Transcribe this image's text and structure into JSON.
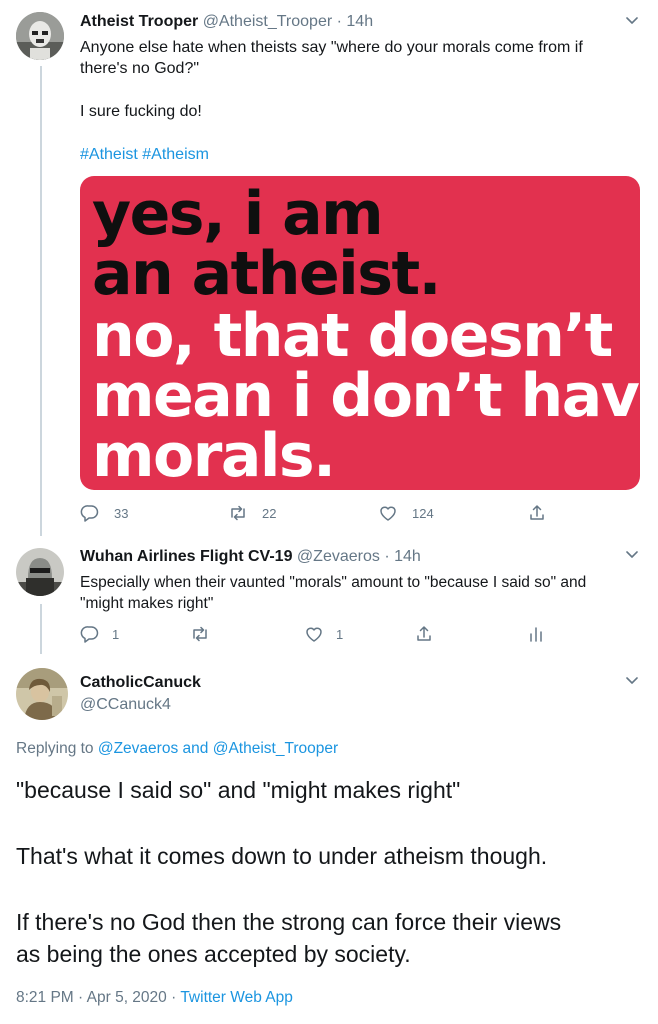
{
  "tweet1": {
    "name": "Atheist Trooper",
    "handle": "@Atheist_Trooper",
    "sep": "·",
    "time": "14h",
    "text_line1": "Anyone else hate when theists say \"where do your morals come from if",
    "text_line2": "there's no God?\"",
    "text_line3": "I sure fucking do!",
    "hashtag1": "#Atheist",
    "hashtag2": "#Atheism",
    "image_lines": [
      "yes, i am",
      "an atheist.",
      "no, that doesn’t",
      "mean i don’t have",
      "morals."
    ],
    "replies": "33",
    "retweets": "22",
    "likes": "124"
  },
  "tweet2": {
    "name": "Wuhan Airlines Flight CV-19",
    "handle": "@Zevaeros",
    "sep": "·",
    "time": "14h",
    "text_line1": "Especially when their vaunted \"morals\" amount to \"because I said so\" and",
    "text_line2": "\"might makes right\"",
    "replies": "1",
    "likes": "1"
  },
  "tweet3": {
    "name": "CatholicCanuck",
    "handle": "@CCanuck4",
    "replying_prefix": "Replying to",
    "replying_user1": "@Zevaeros",
    "replying_and": "and",
    "replying_user2": "@Atheist_Trooper",
    "line1": "\"because I said so\" and \"might makes right\"",
    "line2": "That's what it comes down to under atheism though.",
    "line3": "If there's no God then the strong can force their views",
    "line4": "as being the ones accepted by society.",
    "timestamp": "8:21 PM · Apr 5, 2020",
    "sep": "·",
    "client": "Twitter Web App"
  },
  "colors": {
    "link": "#1b95e0",
    "muted": "#657786",
    "image_bg": "#e2314f",
    "thread_line": "#ccd6dd"
  },
  "icons": [
    "reply-icon",
    "retweet-icon",
    "like-icon",
    "share-icon",
    "analytics-icon",
    "chevron-down-icon"
  ]
}
